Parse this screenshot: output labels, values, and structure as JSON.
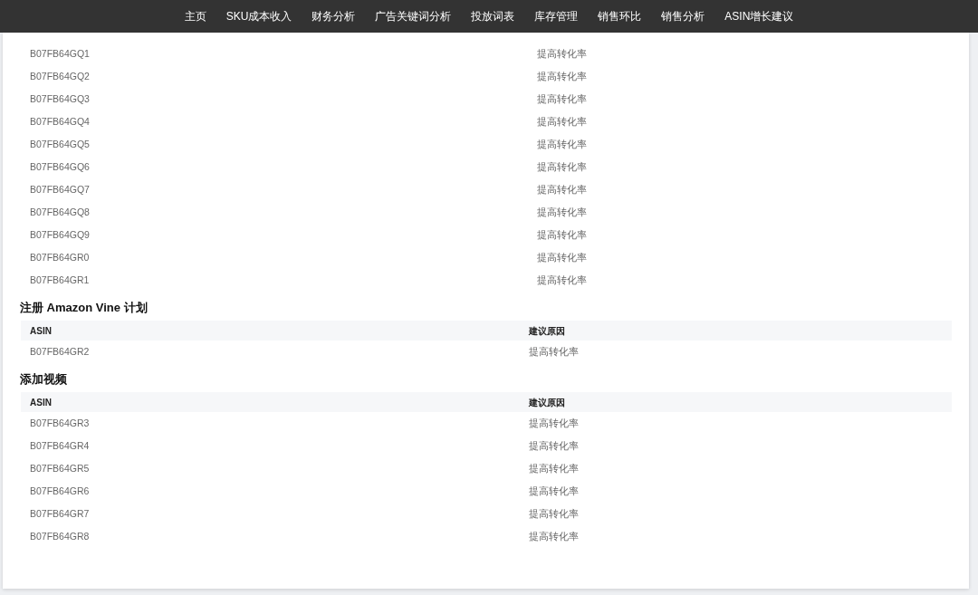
{
  "nav": {
    "items": [
      "主页",
      "SKU成本收入",
      "财务分析",
      "广告关键词分析",
      "投放词表",
      "库存管理",
      "销售环比",
      "销售分析",
      "ASIN增长建议"
    ]
  },
  "sections": [
    {
      "rows": [
        [
          "B07FB64GQ1",
          "提高转化率"
        ],
        [
          "B07FB64GQ2",
          "提高转化率"
        ],
        [
          "B07FB64GQ3",
          "提高转化率"
        ],
        [
          "B07FB64GQ4",
          "提高转化率"
        ],
        [
          "B07FB64GQ5",
          "提高转化率"
        ],
        [
          "B07FB64GQ6",
          "提高转化率"
        ],
        [
          "B07FB64GQ7",
          "提高转化率"
        ],
        [
          "B07FB64GQ8",
          "提高转化率"
        ],
        [
          "B07FB64GQ9",
          "提高转化率"
        ],
        [
          "B07FB64GR0",
          "提高转化率"
        ],
        [
          "B07FB64GR1",
          "提高转化率"
        ]
      ]
    },
    {
      "title": "注册 Amazon Vine 计划",
      "columns": [
        "ASIN",
        "建议原因"
      ],
      "rows": [
        [
          "B07FB64GR2",
          "提高转化率"
        ]
      ]
    },
    {
      "title": "添加视频",
      "columns": [
        "ASIN",
        "建议原因"
      ],
      "rows": [
        [
          "B07FB64GR3",
          "提高转化率"
        ],
        [
          "B07FB64GR4",
          "提高转化率"
        ],
        [
          "B07FB64GR5",
          "提高转化率"
        ],
        [
          "B07FB64GR6",
          "提高转化率"
        ],
        [
          "B07FB64GR7",
          "提高转化率"
        ],
        [
          "B07FB64GR8",
          "提高转化率"
        ]
      ]
    }
  ]
}
